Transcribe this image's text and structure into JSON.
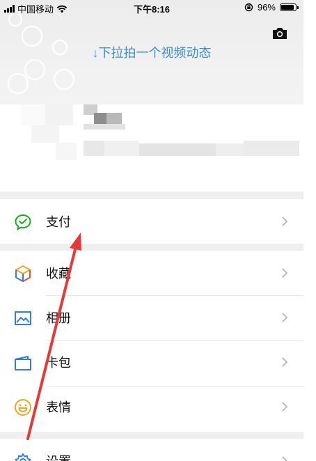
{
  "status_bar": {
    "carrier": "中国移动",
    "time": "下午8:16",
    "battery_text": "96%",
    "battery_level": 0.96
  },
  "header": {
    "pull_hint": "↓下拉拍一个视频动态",
    "camera_icon": "camera-icon"
  },
  "menu": {
    "pay": {
      "label": "支付",
      "icon": "wechat-pay-icon",
      "color": "#1aad19"
    },
    "favorites": {
      "label": "收藏",
      "icon": "cube-icon"
    },
    "album": {
      "label": "相册",
      "icon": "picture-icon",
      "color": "#2f7fd8"
    },
    "cards": {
      "label": "卡包",
      "icon": "wallet-icon",
      "color": "#2f7fd8"
    },
    "stickers": {
      "label": "表情",
      "icon": "smiley-icon",
      "color": "#f2a51a"
    },
    "settings": {
      "label": "设置",
      "icon": "gear-icon",
      "color": "#2f7fd8"
    }
  },
  "annotation": {
    "arrow_color": "#e53935"
  }
}
